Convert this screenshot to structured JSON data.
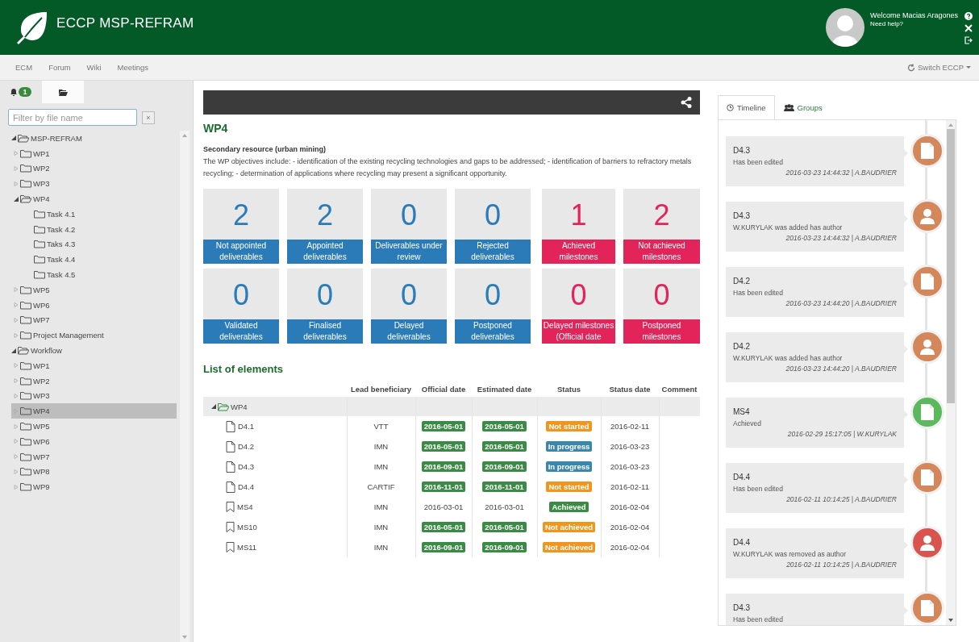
{
  "header": {
    "title": "ECCP MSP-REFRAM",
    "welcome": "Welcome Macias Aragones",
    "help_link": "Need help?"
  },
  "nav": {
    "items": [
      "ECM",
      "Forum",
      "Wiki",
      "Meetings"
    ],
    "switch": "Switch ECCP"
  },
  "sidebar": {
    "tabs": [
      {
        "kind": "notifications",
        "badge": "1",
        "selected": false
      },
      {
        "kind": "files",
        "selected": true
      }
    ],
    "filter": {
      "placeholder": "Filter by file name",
      "clear": "×"
    },
    "tree": [
      {
        "label": "MSP-REFRAM",
        "expanded": true,
        "selected": false,
        "children": [
          {
            "label": "WP1",
            "expanded": false,
            "selected": false
          },
          {
            "label": "WP2",
            "expanded": false,
            "selected": false
          },
          {
            "label": "WP3",
            "expanded": false,
            "selected": false
          },
          {
            "label": "WP4",
            "expanded": true,
            "selected": false,
            "children": [
              {
                "label": "Task 4.1",
                "selected": false
              },
              {
                "label": "Task 4.2",
                "selected": false
              },
              {
                "label": "Taks 4.3",
                "selected": false
              },
              {
                "label": "Task 4.4",
                "selected": false
              },
              {
                "label": "Task 4.5",
                "selected": false
              }
            ]
          },
          {
            "label": "WP5",
            "expanded": false,
            "selected": false
          },
          {
            "label": "WP6",
            "expanded": false,
            "selected": false
          },
          {
            "label": "WP7",
            "expanded": false,
            "selected": false
          },
          {
            "label": "Project Management",
            "expanded": false,
            "selected": false
          }
        ]
      },
      {
        "label": "Workflow",
        "expanded": true,
        "selected": false,
        "children": [
          {
            "label": "WP1",
            "expanded": false,
            "selected": false
          },
          {
            "label": "WP2",
            "expanded": false,
            "selected": false
          },
          {
            "label": "WP3",
            "expanded": false,
            "selected": false
          },
          {
            "label": "WP4",
            "expanded": false,
            "selected": true
          },
          {
            "label": "WP5",
            "expanded": false,
            "selected": false
          },
          {
            "label": "WP6",
            "expanded": false,
            "selected": false
          },
          {
            "label": "WP7",
            "expanded": false,
            "selected": false
          },
          {
            "label": "WP8",
            "expanded": false,
            "selected": false
          },
          {
            "label": "WP9",
            "expanded": false,
            "selected": false
          }
        ]
      }
    ]
  },
  "content": {
    "title": "WP4",
    "subtitle": "Secondary resource (urban mining)",
    "description": "The WP objectives include: - identification of the existing recycling technologies and gaps to be addressed; - identification of barriers to refractory metals recycling; - determination of applications where recycling may present a significant opportunity.",
    "stats": [
      {
        "value": "2",
        "label": "Not appointed deliverables",
        "color": "#2b7bb9"
      },
      {
        "value": "2",
        "label": "Appointed deliverables",
        "color": "#2b7bb9"
      },
      {
        "value": "0",
        "label": "Deliverables under review",
        "color": "#2b7bb9"
      },
      {
        "value": "0",
        "label": "Rejected deliverables",
        "color": "#2b7bb9"
      },
      {
        "value": "1",
        "label": "Achieved milestones",
        "color": "#e3245a"
      },
      {
        "value": "2",
        "label": "Not achieved milestones",
        "color": "#e3245a"
      },
      {
        "value": "0",
        "label": "Validated deliverables",
        "color": "#2b7bb9"
      },
      {
        "value": "0",
        "label": "Finalised deliverables",
        "color": "#2b7bb9"
      },
      {
        "value": "0",
        "label": "Delayed deliverables",
        "color": "#2b7bb9"
      },
      {
        "value": "0",
        "label": "Postponed deliverables",
        "color": "#2b7bb9"
      },
      {
        "value": "0",
        "label": "Delayed milestones (Official date",
        "color": "#e3245a"
      },
      {
        "value": "0",
        "label": "Postponed milestones",
        "color": "#e3245a"
      }
    ],
    "list_title": "List of elements",
    "table": {
      "columns": [
        "Lead beneficiary",
        "Official date",
        "Estimated date",
        "Status",
        "Status date",
        "Comment"
      ],
      "group": {
        "label": "WP4",
        "expanded": true
      },
      "rows": [
        {
          "name": "D4.1",
          "kind": "deliverable",
          "lead": "VTT",
          "official_date": "2016-05-01",
          "estimated_date": "2016-05-01",
          "dates_flagged": true,
          "status": "Not started",
          "color": "#f0961e",
          "status_date": "2016-02-11"
        },
        {
          "name": "D4.2",
          "kind": "deliverable",
          "lead": "IMN",
          "official_date": "2016-05-01",
          "estimated_date": "2016-05-01",
          "dates_flagged": true,
          "status": "In progress",
          "color": "#3a87ad",
          "status_date": "2016-03-23"
        },
        {
          "name": "D4.3",
          "kind": "deliverable",
          "lead": "IMN",
          "official_date": "2016-09-01",
          "estimated_date": "2016-09-01",
          "dates_flagged": true,
          "status": "In progress",
          "color": "#3a87ad",
          "status_date": "2016-03-23"
        },
        {
          "name": "D4.4",
          "kind": "deliverable",
          "lead": "CARTIF",
          "official_date": "2016-11-01",
          "estimated_date": "2016-11-01",
          "dates_flagged": true,
          "status": "Not started",
          "color": "#f0961e",
          "status_date": "2016-02-11"
        },
        {
          "name": "MS4",
          "kind": "milestone",
          "lead": "IMN",
          "official_date": "2016-03-01",
          "estimated_date": "2016-03-01",
          "dates_flagged": false,
          "status": "Achieved",
          "color": "#3b8a45",
          "status_date": "2016-02-04"
        },
        {
          "name": "MS10",
          "kind": "milestone",
          "lead": "IMN",
          "official_date": "2016-05-01",
          "estimated_date": "2016-05-01",
          "dates_flagged": true,
          "status": "Not achieved",
          "color": "#f0961e",
          "status_date": "2016-02-04"
        },
        {
          "name": "MS11",
          "kind": "milestone",
          "lead": "IMN",
          "official_date": "2016-09-01",
          "estimated_date": "2016-09-01",
          "dates_flagged": true,
          "status": "Not achieved",
          "color": "#f0961e",
          "status_date": "2016-02-04"
        }
      ]
    }
  },
  "timeline": {
    "tabs": [
      {
        "label": "Timeline",
        "kind": "timeline",
        "selected": true
      },
      {
        "label": "Groups",
        "kind": "groups",
        "selected": false
      }
    ],
    "entries": [
      {
        "title": "D4.3",
        "text": "Has been edited",
        "meta": "2016-03-23 14:44:32 | A.BAUDRIER",
        "kind": "document",
        "color": "#d4875a"
      },
      {
        "title": "D4.3",
        "text": "W.KURYLAK was added has author",
        "meta": "2016-03-23 14:44:32 | A.BAUDRIER",
        "kind": "person",
        "color": "#d4875a"
      },
      {
        "title": "D4.2",
        "text": "Has been edited",
        "meta": "2016-03-23 14:44:20 | A.BAUDRIER",
        "kind": "document",
        "color": "#d4875a"
      },
      {
        "title": "D4.2",
        "text": "W.KURYLAK was added has author",
        "meta": "2016-03-23 14:44:20 | A.BAUDRIER",
        "kind": "person",
        "color": "#d4875a"
      },
      {
        "title": "MS4",
        "text": "Achieved",
        "meta": "2016-02-29 15:17:05 | W.KURYLAK",
        "kind": "document",
        "color": "#5cb85c"
      },
      {
        "title": "D4.4",
        "text": "Has been edited",
        "meta": "2016-02-11 10:14:25 | A.BAUDRIER",
        "kind": "document",
        "color": "#d4875a"
      },
      {
        "title": "D4.4",
        "text": "W.KURYLAK was removed as author",
        "meta": "2016-02-11 10:14:25 | A.BAUDRIER",
        "kind": "person",
        "color": "#d9534f"
      },
      {
        "title": "D4.3",
        "text": "Has been edited",
        "kind": "document",
        "color": "#d4875a"
      }
    ]
  }
}
